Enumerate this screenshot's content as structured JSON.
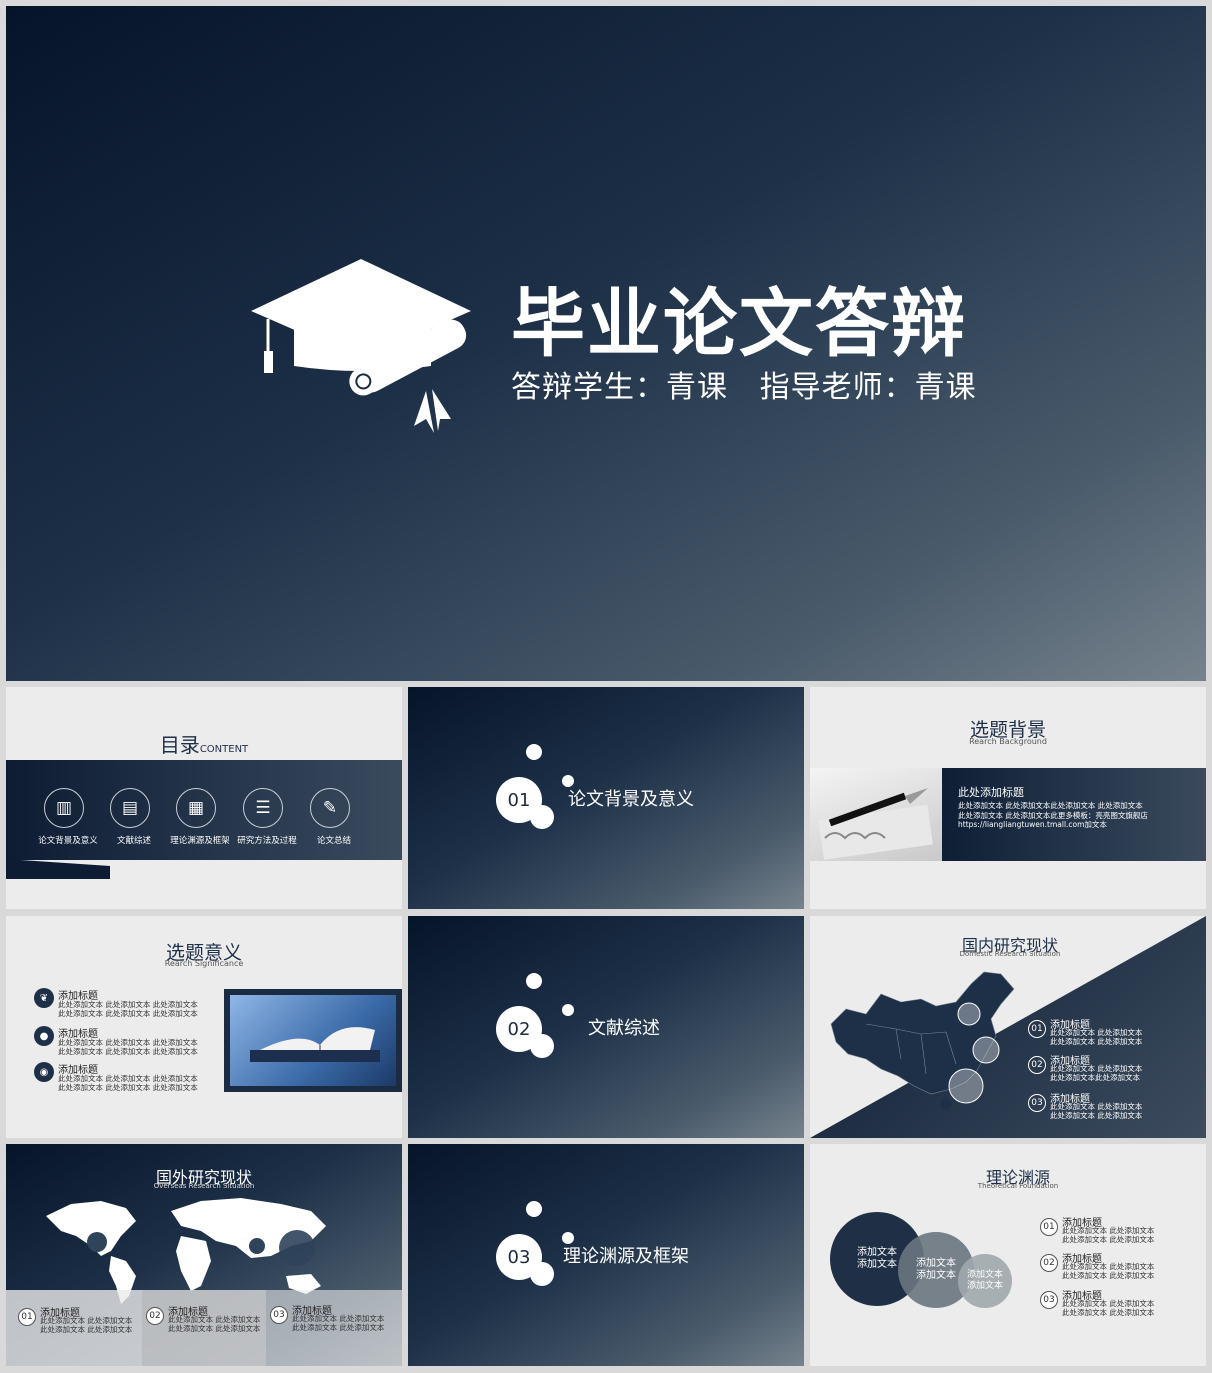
{
  "hero": {
    "title": "毕业论文答辩",
    "subtitle": "答辩学生：青课   指导老师：青课",
    "icon": "graduation-cap-icon"
  },
  "toc": {
    "title": "目录",
    "title_en": "CONTENT",
    "items": [
      {
        "label": "论文背景及意义",
        "icon": "books-icon"
      },
      {
        "label": "文献综述",
        "icon": "book-icon"
      },
      {
        "label": "理论渊源及框架",
        "icon": "document-icon"
      },
      {
        "label": "研究方法及过程",
        "icon": "list-icon"
      },
      {
        "label": "论文总结",
        "icon": "pen-icon"
      }
    ]
  },
  "sections": [
    {
      "num": "01",
      "title": "论文背景及意义"
    },
    {
      "num": "02",
      "title": "文献综述"
    },
    {
      "num": "03",
      "title": "理论渊源及框架"
    }
  ],
  "background": {
    "title": "选题背景",
    "title_en": "Rearch Background",
    "panel_title": "此处添加标题",
    "panel_text": "此处添加文本 此处添加文本此处添加文本 此处添加文本\n此处添加文本 此处添加文本此更多模板：亮亮图文旗舰店\nhttps://liangliangtuwen.tmall.com加文本"
  },
  "significance": {
    "title": "选题意义",
    "title_en": "Rearch Significance",
    "items": [
      {
        "title": "添加标题",
        "text": "此处添加文本 此处添加文本 此处添加文本\n此处添加文本 此处添加文本 此处添加文本",
        "icon": "leaf-icon"
      },
      {
        "title": "添加标题",
        "text": "此处添加文本 此处添加文本 此处添加文本\n此处添加文本 此处添加文本 此处添加文本",
        "icon": "bulb-icon"
      },
      {
        "title": "添加标题",
        "text": "此处添加文本 此处添加文本 此处添加文本\n此处添加文本 此处添加文本 此处添加文本",
        "icon": "globe-icon"
      }
    ]
  },
  "domestic": {
    "title": "国内研究现状",
    "title_en": "Domestic Research  Situation",
    "items": [
      {
        "num": "01",
        "title": "添加标题",
        "text": "此处添加文本 此处添加文本\n此处添加文本 此处添加文本"
      },
      {
        "num": "02",
        "title": "添加标题",
        "text": "此处添加文本 此处添加文本\n此处添加文本此处添加文本"
      },
      {
        "num": "03",
        "title": "添加标题",
        "text": "此处添加文本 此处添加文本\n此处添加文本 此处添加文本"
      }
    ]
  },
  "overseas": {
    "title": "国外研究现状",
    "title_en": "Overseas Research  Situation",
    "items": [
      {
        "num": "01",
        "title": "添加标题",
        "text": "此处添加文本 此处添加文本\n此处添加文本 此处添加文本"
      },
      {
        "num": "02",
        "title": "添加标题",
        "text": "此处添加文本 此处添加文本\n此处添加文本 此处添加文本"
      },
      {
        "num": "03",
        "title": "添加标题",
        "text": "此处添加文本 此处添加文本\n此处添加文本 此处添加文本"
      }
    ]
  },
  "theory": {
    "title": "理论渊源",
    "title_en": "Theoretical Foundation",
    "circles": [
      "添加文本\n添加文本",
      "添加文本\n添加文本",
      "添加文本\n添加文本"
    ],
    "items": [
      {
        "num": "01",
        "title": "添加标题",
        "text": "此处添加文本 此处添加文本\n此处添加文本 此处添加文本"
      },
      {
        "num": "02",
        "title": "添加标题",
        "text": "此处添加文本 此处添加文本\n此处添加文本 此处添加文本"
      },
      {
        "num": "03",
        "title": "添加标题",
        "text": "此处添加文本 此处添加文本\n此处添加文本 此处添加文本"
      }
    ]
  }
}
